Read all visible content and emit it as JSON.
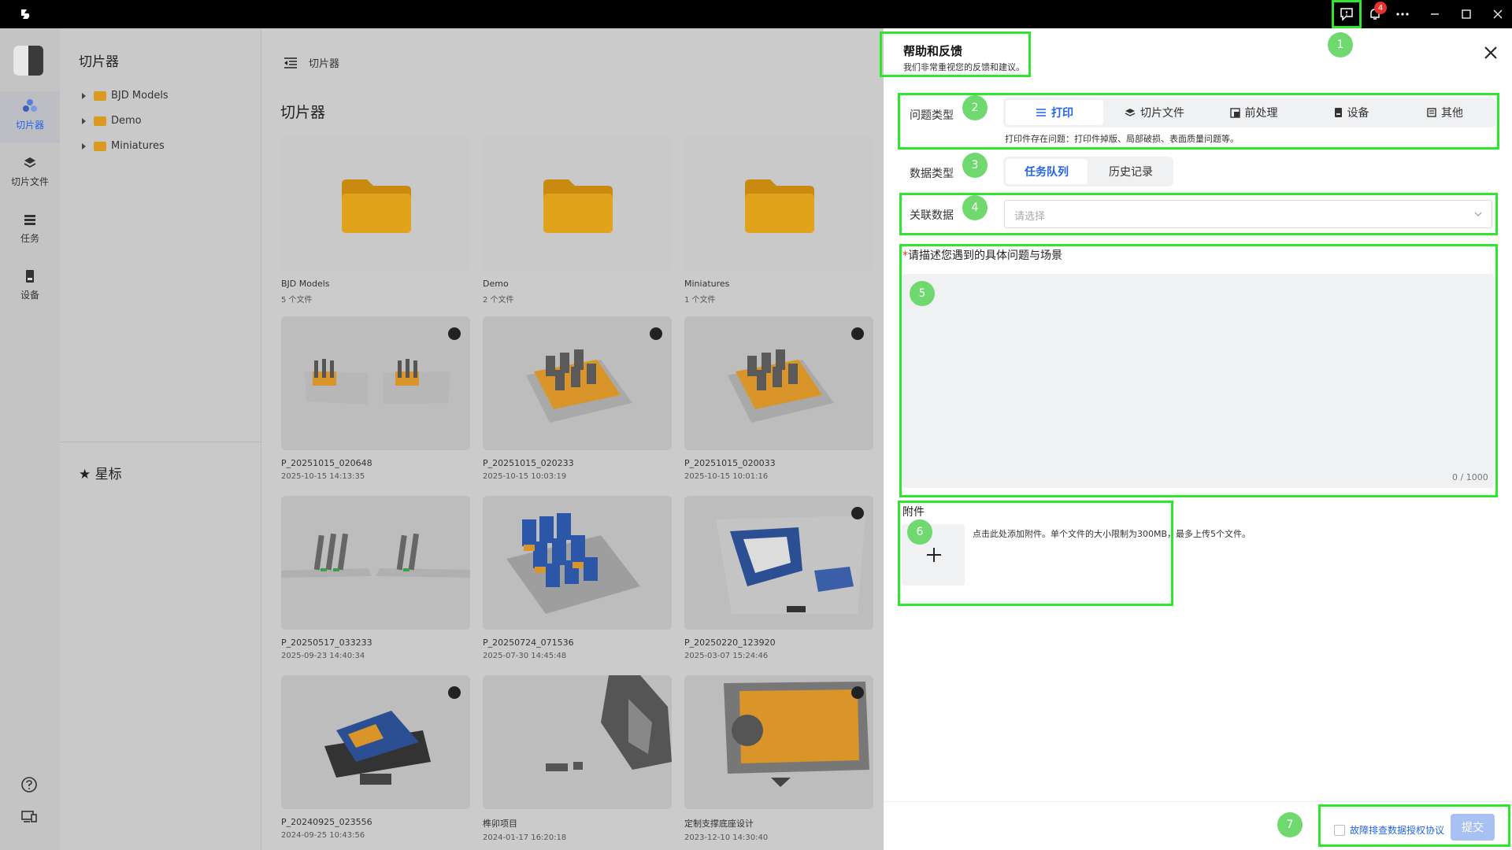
{
  "titlebar": {
    "notification_count": "4"
  },
  "rail": {
    "items": [
      {
        "label": "切片器",
        "icon": "slicer-icon"
      },
      {
        "label": "切片文件",
        "icon": "layers-icon"
      },
      {
        "label": "任务",
        "icon": "task-list-icon"
      },
      {
        "label": "设备",
        "icon": "printer-icon"
      }
    ],
    "accent": "#2364e8"
  },
  "tree": {
    "title": "切片器",
    "items": [
      {
        "label": "BJD Models"
      },
      {
        "label": "Demo"
      },
      {
        "label": "Miniatures"
      }
    ],
    "starred_label": "星标"
  },
  "main": {
    "breadcrumb": "切片器",
    "title": "切片器",
    "cards": [
      {
        "name": "BJD Models",
        "meta": "5 个文件"
      },
      {
        "name": "Demo",
        "meta": "2 个文件"
      },
      {
        "name": "Miniatures",
        "meta": "1 个文件"
      },
      {
        "name": "P_20251015_020648",
        "meta": "2025-10-15 14:13:35"
      },
      {
        "name": "P_20251015_020233",
        "meta": "2025-10-15 10:03:19"
      },
      {
        "name": "P_20251015_020033",
        "meta": "2025-10-15 10:01:16"
      },
      {
        "name": "P_20250517_033233",
        "meta": "2025-09-23 14:40:34"
      },
      {
        "name": "P_20250724_071536",
        "meta": "2025-07-30 14:45:48"
      },
      {
        "name": "P_20250220_123920",
        "meta": "2025-03-07 15:24:46"
      },
      {
        "name": "P_20240925_023556",
        "meta": "2024-09-25 10:43:56"
      },
      {
        "name": "榫卯项目",
        "meta": "2024-01-17 16:20:18"
      },
      {
        "name": "定制支撑底座设计",
        "meta": "2023-12-10 14:30:40"
      }
    ]
  },
  "help": {
    "title": "帮助和反馈",
    "subtitle": "我们非常重视您的反馈和建议。",
    "issue_type_label": "问题类型",
    "issue_types": [
      {
        "label": "打印",
        "icon": "list-icon"
      },
      {
        "label": "切片文件",
        "icon": "layers-icon"
      },
      {
        "label": "前处理",
        "icon": "preprocess-icon"
      },
      {
        "label": "设备",
        "icon": "printer-icon"
      },
      {
        "label": "其他",
        "icon": "document-icon"
      }
    ],
    "issue_hint": "打印件存在问题：打印件掉版、局部破损、表面质量问题等。",
    "data_type_label": "数据类型",
    "data_types": [
      "任务队列",
      "历史记录"
    ],
    "assoc_label": "关联数据",
    "assoc_placeholder": "请选择",
    "desc_label": "请描述您遇到的具体问题与场景",
    "desc_required_mark": "*",
    "desc_count": "0 / 1000",
    "attach_label": "附件",
    "attach_hint": "点击此处添加附件。单个文件的大小限制为300MB，最多上传5个文件。",
    "agree_text": "故障排查数据授权协议",
    "submit_label": "提交",
    "annotations": [
      "1",
      "2",
      "3",
      "4",
      "5",
      "6",
      "7"
    ],
    "highlight_color": "#2ee62e"
  }
}
